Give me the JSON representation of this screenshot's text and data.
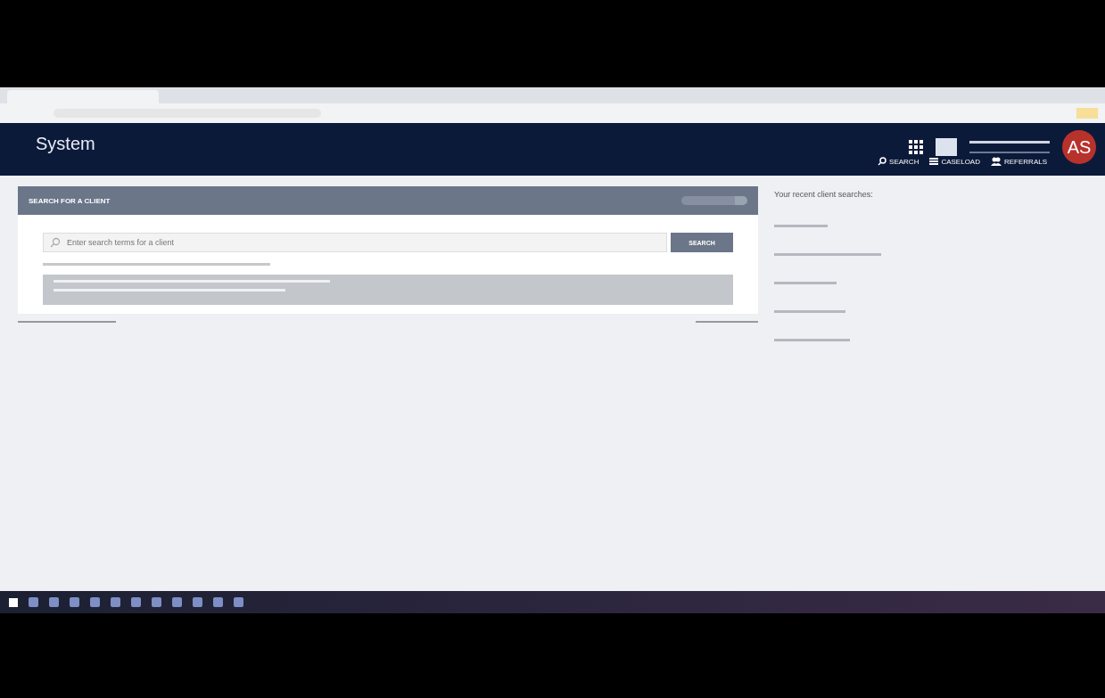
{
  "app": {
    "title": "System",
    "avatar_initials": "AS"
  },
  "nav": [
    {
      "label": "SEARCH",
      "kind": "search"
    },
    {
      "label": "CASELOAD",
      "kind": "list"
    },
    {
      "label": "REFERRALS",
      "kind": "people"
    }
  ],
  "search_panel": {
    "title": "SEARCH FOR A CLIENT",
    "placeholder": "Enter search terms for a client",
    "button": "SEARCH"
  },
  "recent": {
    "title": "Your recent client searches:"
  }
}
